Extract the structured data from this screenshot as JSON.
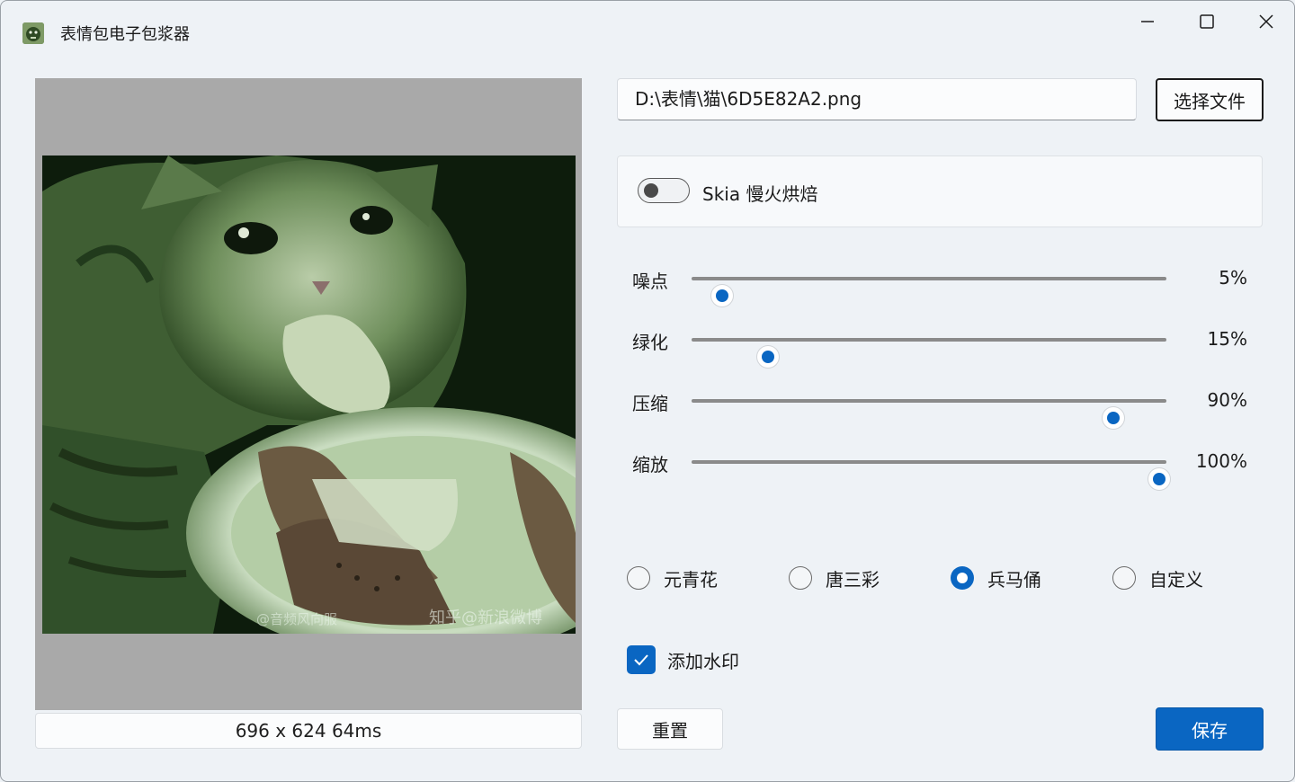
{
  "window": {
    "title": "表情包电子包浆器",
    "controls": [
      "minimize",
      "maximize",
      "close"
    ]
  },
  "preview": {
    "info": "696 x 624 64ms",
    "watermark_left": "@音频风向服",
    "watermark_right": "知乎@新浪微博"
  },
  "file": {
    "path": "D:\\表情\\猫\\6D5E82A2.png",
    "choose_label": "选择文件"
  },
  "skia": {
    "label": "Skia 慢火烘焙",
    "enabled": false
  },
  "sliders": [
    {
      "label": "噪点",
      "value": 5,
      "display": "5%"
    },
    {
      "label": "绿化",
      "value": 15,
      "display": "15%"
    },
    {
      "label": "压缩",
      "value": 90,
      "display": "90%"
    },
    {
      "label": "缩放",
      "value": 100,
      "display": "100%"
    }
  ],
  "presets": [
    {
      "label": "元青花",
      "checked": false
    },
    {
      "label": "唐三彩",
      "checked": false
    },
    {
      "label": "兵马俑",
      "checked": true
    },
    {
      "label": "自定义",
      "checked": false
    }
  ],
  "watermark": {
    "label": "添加水印",
    "checked": true
  },
  "actions": {
    "reset_label": "重置",
    "save_label": "保存"
  },
  "colors": {
    "accent": "#0a66c2",
    "background": "#eef2f6",
    "preview_bg": "#a9a9a9"
  }
}
